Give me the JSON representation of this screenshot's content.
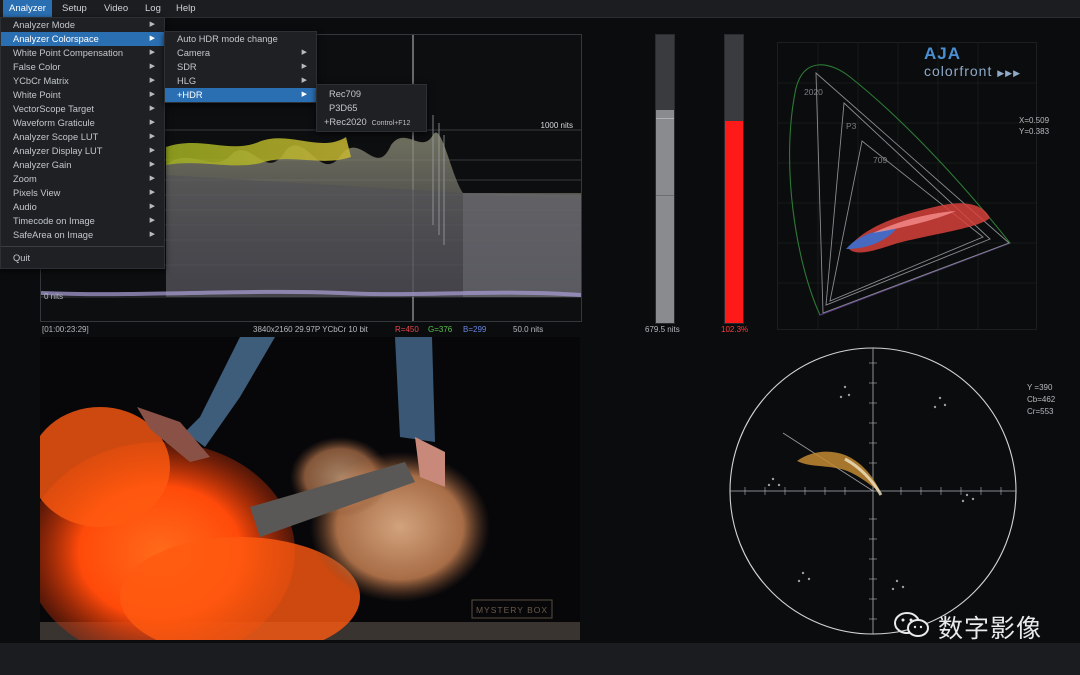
{
  "menubar": {
    "items": [
      "Analyzer",
      "Setup",
      "Video",
      "Log",
      "Help"
    ],
    "active": "Analyzer"
  },
  "analyzer_menu": {
    "items": [
      {
        "label": "Analyzer Mode",
        "submenu": true
      },
      {
        "label": "Analyzer Colorspace",
        "submenu": true,
        "highlighted": true
      },
      {
        "label": "White Point Compensation",
        "submenu": true
      },
      {
        "label": "False Color",
        "submenu": true
      },
      {
        "label": "YCbCr Matrix",
        "submenu": true
      },
      {
        "label": "White Point",
        "submenu": true
      },
      {
        "label": "VectorScope Target",
        "submenu": true
      },
      {
        "label": "Waveform Graticule",
        "submenu": true
      },
      {
        "label": "Analyzer Scope LUT",
        "submenu": true
      },
      {
        "label": "Analyzer Display LUT",
        "submenu": true
      },
      {
        "label": "Analyzer Gain",
        "submenu": true
      },
      {
        "label": "Zoom",
        "submenu": true
      },
      {
        "label": "Pixels View",
        "submenu": true
      },
      {
        "label": "Audio",
        "submenu": true
      },
      {
        "label": "Timecode on Image",
        "submenu": true
      },
      {
        "label": "SafeArea on Image",
        "submenu": true
      }
    ],
    "quit": "Quit"
  },
  "colorspace_submenu": {
    "items": [
      {
        "label": "Auto HDR mode change",
        "submenu": false
      },
      {
        "label": "Camera",
        "submenu": true
      },
      {
        "label": "SDR",
        "submenu": true
      },
      {
        "label": "HLG",
        "submenu": true
      },
      {
        "label": "+HDR",
        "submenu": true,
        "highlighted": true
      }
    ]
  },
  "hdr_submenu": {
    "items": [
      {
        "label": "Rec709",
        "shortcut": ""
      },
      {
        "label": "P3D65",
        "shortcut": ""
      },
      {
        "label": "+Rec2020",
        "shortcut": "Control+F12"
      }
    ]
  },
  "waveform": {
    "top_label": "1000 nits",
    "bottom_label": "0 nits",
    "timecode": "[01:00:23:29]",
    "format": "3840x2160 29.97P YCbCr 10 bit",
    "r": "R=450",
    "g": "G=376",
    "b": "B=299",
    "nits": "50.0 nits",
    "colors": {
      "r": "#e0484f",
      "g": "#5bbf4e",
      "b": "#5a79d6"
    }
  },
  "meters": {
    "left_label": "679.5 nits",
    "left_level": 0.74,
    "right_label": "102.3%",
    "right_level": 0.7,
    "right_color": "#ff1a1a"
  },
  "cie": {
    "logo_brand": "AJA",
    "logo_product": "colorfront",
    "gamut_labels": [
      "2020",
      "P3",
      "709"
    ],
    "x_readout": "X=0.509",
    "y_readout": "Y=0.383"
  },
  "vectorscope": {
    "y": "Y =390",
    "cb": "Cb=462",
    "cr": "Cr=553"
  },
  "image": {
    "caption": "MYSTERY BOX"
  },
  "watermark": {
    "text": "数字影像"
  }
}
